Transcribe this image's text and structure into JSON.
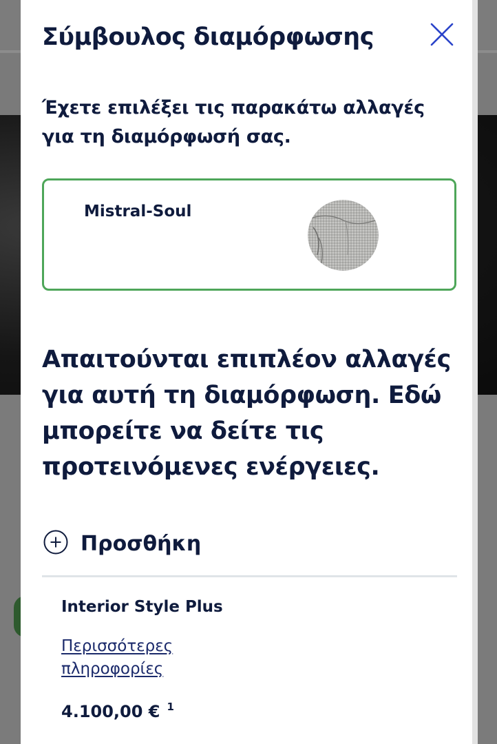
{
  "modal": {
    "title": "Σύμβουλος διαμόρφωσης",
    "close_icon": "close-icon",
    "intro_text": "Έχετε επιλέξει τις παρακάτω αλλαγές για τη διαμόρφωσή σας.",
    "selected_change": {
      "name": "Mistral-Soul",
      "thumbnail_icon": "seat-fabric-thumbnail"
    },
    "required_heading": "Απαιτούνται επιπλέον αλλαγές για αυτή τη διαμόρφωση. Εδώ μπορείτε να δείτε τις προτεινόμενες ενέργειες.",
    "add_section": {
      "icon": "plus-circle-icon",
      "label": "Προσθήκη"
    },
    "suggested_item": {
      "name": "Interior Style Plus",
      "more_info_link": "Περισσότερες πληροφορίες",
      "price": "4.100,00 €",
      "price_footnote": "1"
    }
  },
  "colors": {
    "text_primary": "#0f1b3d",
    "accent_blue": "#2a43c9",
    "card_border_green": "#4ea659",
    "divider": "#dfe4e8",
    "overlay_background": "#7d7d7d"
  }
}
